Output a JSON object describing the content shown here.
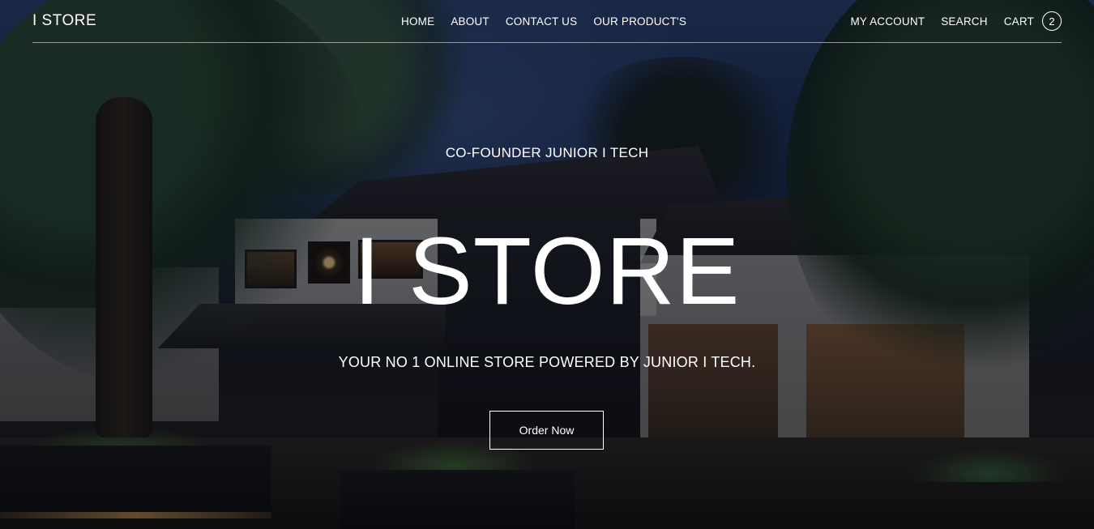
{
  "header": {
    "brand": "I STORE",
    "nav": [
      {
        "label": "HOME"
      },
      {
        "label": "ABOUT"
      },
      {
        "label": "CONTACT US"
      },
      {
        "label": "OUR PRODUCT'S"
      }
    ],
    "account_label": "MY ACCOUNT",
    "search_label": "SEARCH",
    "cart_label": "CART",
    "cart_count": "2"
  },
  "hero": {
    "eyebrow": "CO-FOUNDER JUNIOR I TECH",
    "title": "I STORE",
    "tagline": "YOUR NO 1 ONLINE STORE POWERED BY JUNIOR I TECH.",
    "cta_label": "Order Now",
    "background_image": "night-exterior-restaurant-photo"
  },
  "colors": {
    "text": "#ffffff",
    "overlay": "#050810"
  }
}
